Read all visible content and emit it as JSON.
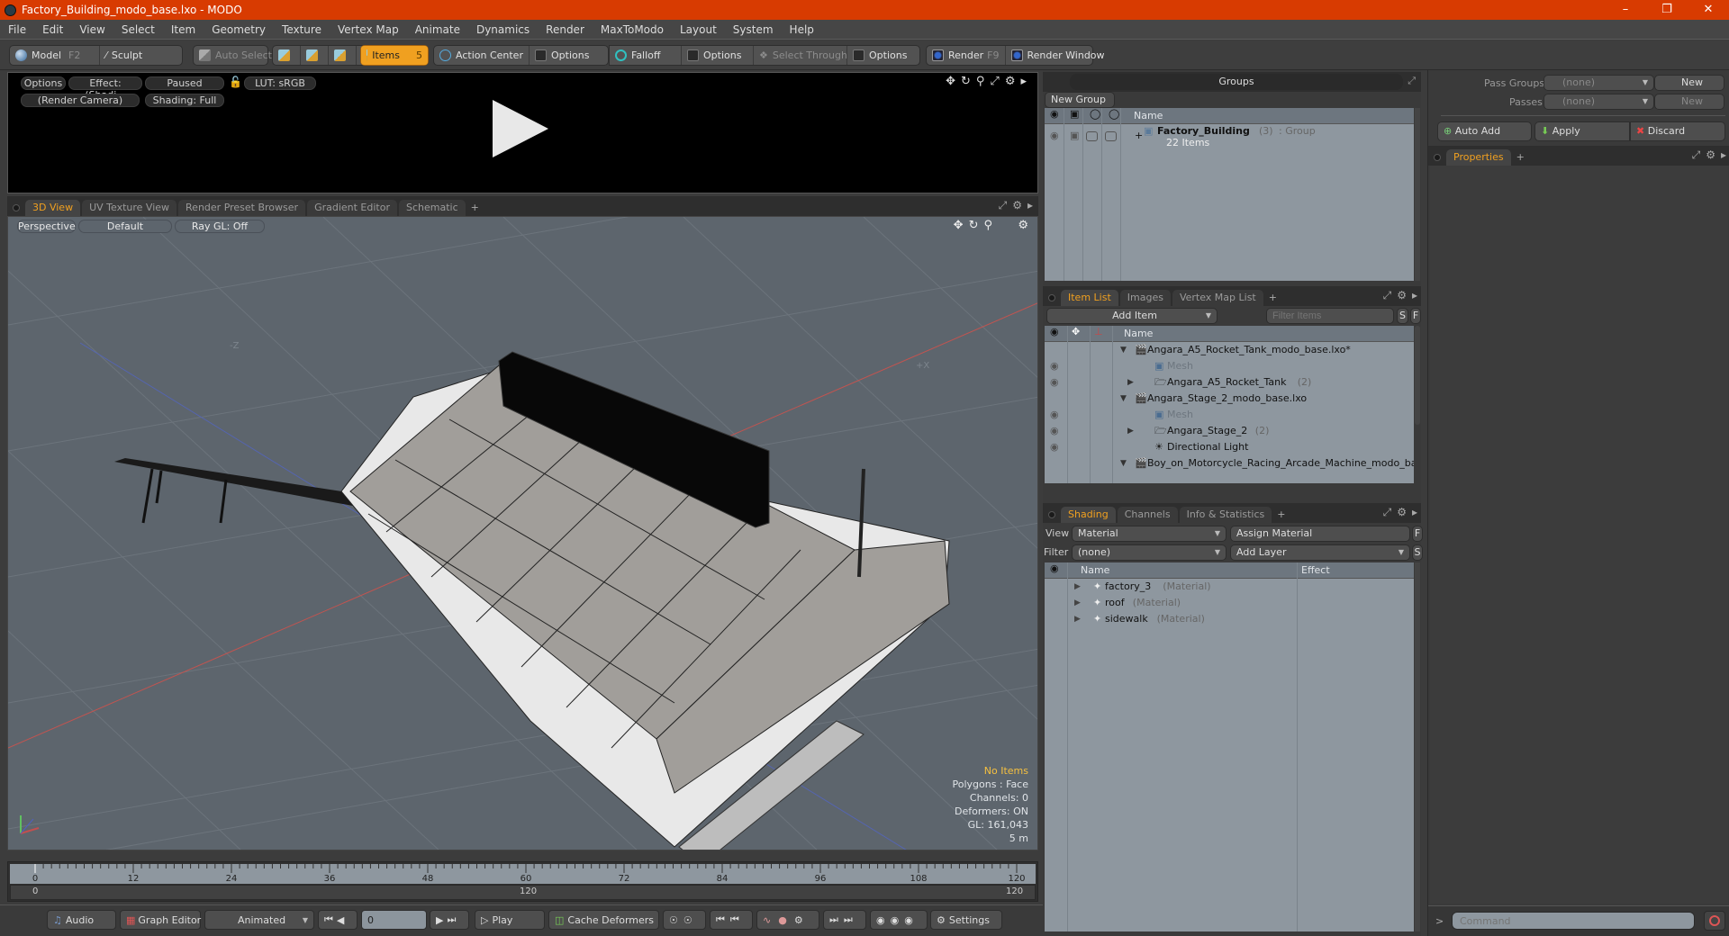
{
  "window": {
    "title": "Factory_Building_modo_base.lxo - MODO",
    "controls": [
      "minimize",
      "restore",
      "close"
    ]
  },
  "menu": [
    "File",
    "Edit",
    "View",
    "Select",
    "Item",
    "Geometry",
    "Texture",
    "Vertex Map",
    "Animate",
    "Dynamics",
    "Render",
    "MaxToModo",
    "Layout",
    "System",
    "Help"
  ],
  "toolbar": {
    "model_label": "Model",
    "model_key": "F2",
    "sculpt_label": "Sculpt",
    "auto_select_label": "Auto Select",
    "items_label": "Items",
    "items_key": "5",
    "action_center_label": "Action Center",
    "options1_label": "Options",
    "falloff_label": "Falloff",
    "options2_label": "Options",
    "select_through_label": "Select Through",
    "options3_label": "Options",
    "render_label": "Render",
    "render_key": "F9",
    "render_window_label": "Render Window"
  },
  "render_preview": {
    "options_label": "Options",
    "effect_label": "Effect: (Shadi...",
    "status_label": "Paused",
    "lut_label": "LUT: sRGB",
    "camera_label": "(Render Camera)",
    "shading_label": "Shading: Full"
  },
  "viewport_tabs": [
    {
      "label": "3D View",
      "active": true
    },
    {
      "label": "UV Texture View",
      "active": false
    },
    {
      "label": "Render Preset Browser",
      "active": false
    },
    {
      "label": "Gradient Editor",
      "active": false
    },
    {
      "label": "Schematic",
      "active": false
    }
  ],
  "viewport": {
    "projection_label": "Perspective",
    "style_label": "Default",
    "raygl_label": "Ray GL: Off",
    "axis_labels": {
      "neg_z": "-Z",
      "pos_x": "+X"
    },
    "hud": {
      "selection": "No Items",
      "polygons": "Polygons : Face",
      "channels": "Channels: 0",
      "deformers": "Deformers: ON",
      "gl": "GL: 161,043",
      "scale": "5 m"
    }
  },
  "timeline": {
    "ticks": [
      "0",
      "12",
      "24",
      "36",
      "48",
      "60",
      "72",
      "84",
      "96",
      "108",
      "120"
    ],
    "range_start": "0",
    "range_mid": "120",
    "range_end": "120"
  },
  "bottom_bar": {
    "audio_label": "Audio",
    "graph_editor_label": "Graph Editor",
    "animated_label": "Animated",
    "current_frame": "0",
    "play_label": "Play",
    "cache_deformers_label": "Cache Deformers",
    "settings_label": "Settings"
  },
  "groups_panel": {
    "title": "Groups",
    "new_group_label": "New Group",
    "name_header": "Name",
    "groups": [
      {
        "name": "Factory_Building",
        "count": "(3)",
        "type": ": Group",
        "items": "22 Items"
      }
    ]
  },
  "pass_panel": {
    "pass_groups_label": "Pass Groups",
    "pass_groups_value": "(none)",
    "passes_label": "Passes",
    "passes_value": "(none)",
    "new_label": "New",
    "new_label_disabled": "New",
    "auto_add_label": "Auto Add",
    "apply_label": "Apply",
    "discard_label": "Discard"
  },
  "properties_panel": {
    "tab_label": "Properties"
  },
  "item_list_panel": {
    "tabs": [
      {
        "label": "Item List",
        "active": true
      },
      {
        "label": "Images",
        "active": false
      },
      {
        "label": "Vertex Map List",
        "active": false
      }
    ],
    "add_item_label": "Add Item",
    "filter_placeholder": "Filter Items",
    "s_label": "S",
    "f_label": "F",
    "name_header": "Name",
    "items": [
      {
        "name": "Angara_A5_Rocket_Tank_modo_base.lxo*",
        "type": "scene",
        "depth": 0,
        "count": "",
        "visible": false,
        "dim": false
      },
      {
        "name": "Mesh",
        "type": "mesh",
        "depth": 1,
        "count": "",
        "visible": true,
        "dim": true
      },
      {
        "name": "Angara_A5_Rocket_Tank",
        "type": "folder",
        "depth": 1,
        "count": "(2)",
        "visible": true,
        "dim": false
      },
      {
        "name": "Angara_Stage_2_modo_base.lxo",
        "type": "scene",
        "depth": 0,
        "count": "",
        "visible": false,
        "dim": false
      },
      {
        "name": "Mesh",
        "type": "mesh",
        "depth": 1,
        "count": "",
        "visible": true,
        "dim": true
      },
      {
        "name": "Angara_Stage_2",
        "type": "folder",
        "depth": 1,
        "count": "(2)",
        "visible": true,
        "dim": false
      },
      {
        "name": "Directional Light",
        "type": "light",
        "depth": 1,
        "count": "",
        "visible": true,
        "dim": false
      },
      {
        "name": "Boy_on_Motorcycle_Racing_Arcade_Machine_modo_base....",
        "type": "scene",
        "depth": 0,
        "count": "",
        "visible": false,
        "dim": false
      }
    ]
  },
  "shading_panel": {
    "tabs": [
      {
        "label": "Shading",
        "active": true
      },
      {
        "label": "Channels",
        "active": false
      },
      {
        "label": "Info & Statistics",
        "active": false
      }
    ],
    "view_label": "View",
    "view_value": "Material",
    "assign_material_label": "Assign Material",
    "filter_label": "Filter",
    "filter_value": "(none)",
    "add_layer_label": "Add Layer",
    "f_label": "F",
    "s_label": "S",
    "name_header": "Name",
    "effect_header": "Effect",
    "materials": [
      {
        "name": "factory_3",
        "type": "(Material)"
      },
      {
        "name": "roof",
        "type": "(Material)"
      },
      {
        "name": "sidewalk",
        "type": "(Material)"
      }
    ]
  },
  "command": {
    "placeholder": "Command",
    "prompt": ">"
  }
}
